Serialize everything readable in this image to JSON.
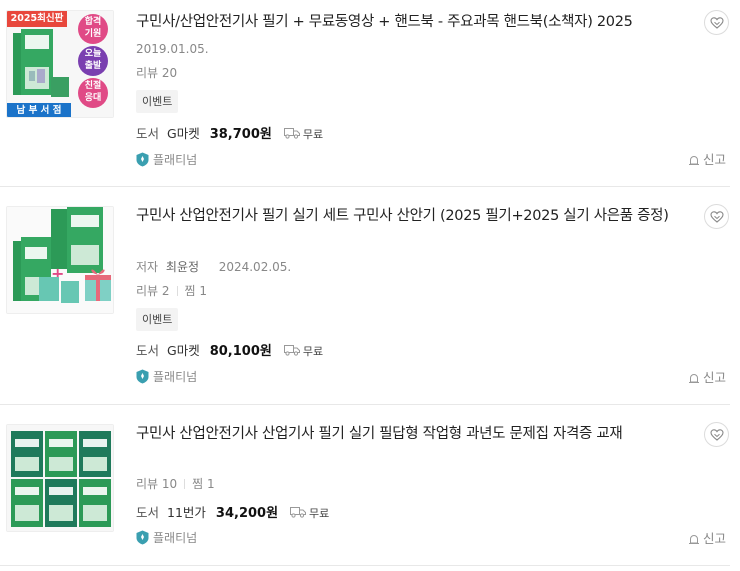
{
  "items": [
    {
      "title": "구민사/산업안전기사 필기 + 무료동영상 + 핸드북 - 주요과목 핸드북(소책자) 2025",
      "date": "2019.01.05.",
      "review_label": "리뷰 20",
      "event_tag": "이벤트",
      "category": "도서",
      "store": "G마켓",
      "price": "38,700원",
      "shipping": "무료",
      "grade": "플래티넘",
      "report": "신고",
      "cover": {
        "top_badge": "2025최신판",
        "circle1": "합격\n기원",
        "circle2": "오늘\n출발",
        "circle3": "친절\n응대",
        "bottom_banner": "남 부 서 점"
      }
    },
    {
      "title": "구민사 산업안전기사 필기 실기 세트 구민사 산안기 (2025 필기+2025 실기 사은품 증정)",
      "author_label": "저자",
      "author": "최윤정",
      "date": "2024.02.05.",
      "review_label": "리뷰 2",
      "zzim_label": "찜 1",
      "event_tag": "이벤트",
      "category": "도서",
      "store": "G마켓",
      "price": "80,100원",
      "shipping": "무료",
      "grade": "플래티넘",
      "report": "신고"
    },
    {
      "title": "구민사 산업안전기사 산업기사 필기 실기 필답형 작업형 과년도 문제집 자격증 교재",
      "review_label": "리뷰 10",
      "zzim_label": "찜 1",
      "category": "도서",
      "store": "11번가",
      "price": "34,200원",
      "shipping": "무료",
      "grade": "플래티넘",
      "report": "신고"
    }
  ],
  "colors": {
    "cover_green": "#2c9a57",
    "badge_red": "#e8473c",
    "banner_blue": "#1b73c9",
    "grade_teal": "#3a9fb0"
  }
}
